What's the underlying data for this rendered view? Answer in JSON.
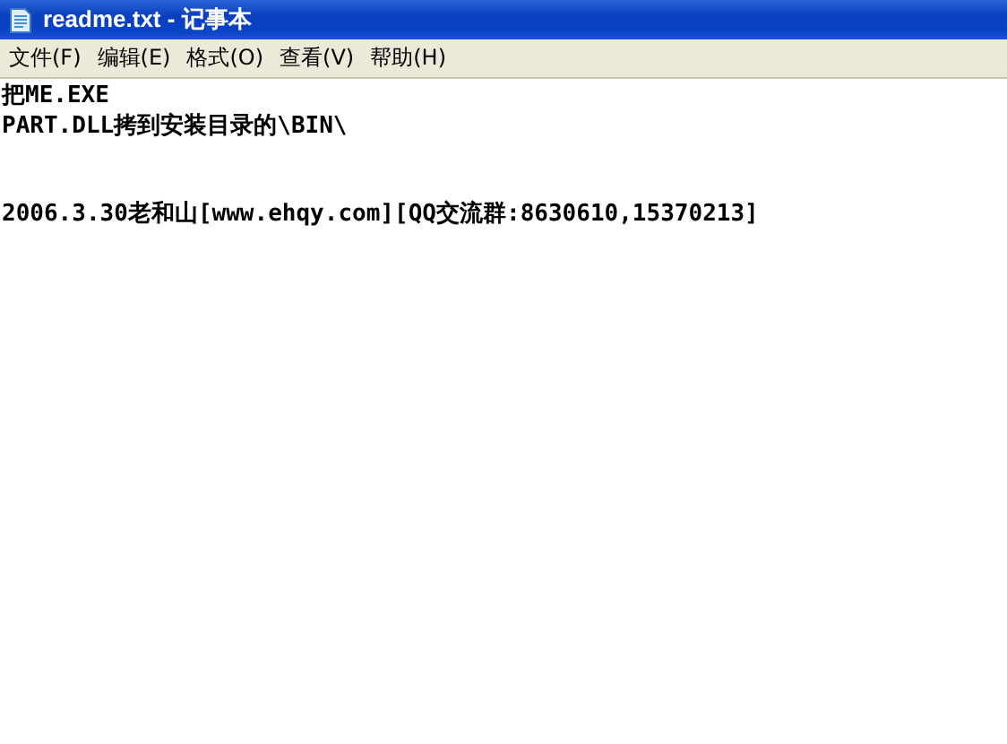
{
  "window": {
    "title": "readme.txt - 记事本"
  },
  "menu": [
    "文件(F)",
    "编辑(E)",
    "格式(O)",
    "查看(V)",
    "帮助(H)"
  ],
  "document": {
    "text": "把ME.EXE\nPART.DLL拷到安装目录的\\BIN\\\n\n\n2006.3.30老和山[www.ehqy.com][QQ交流群:8630610,15370213]"
  }
}
